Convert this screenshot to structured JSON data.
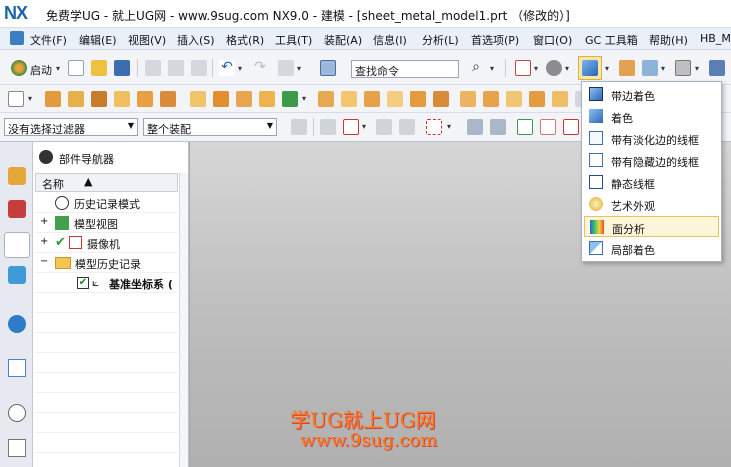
{
  "window": {
    "logo": "NX",
    "title": "免费学UG - 就上UG网 - www.9sug.com NX9.0 - 建模 - [sheet_metal_model1.prt （修改的）]"
  },
  "menubar": [
    {
      "label": "文件(F)"
    },
    {
      "label": "编辑(E)"
    },
    {
      "label": "视图(V)"
    },
    {
      "label": "插入(S)"
    },
    {
      "label": "格式(R)"
    },
    {
      "label": "工具(T)"
    },
    {
      "label": "装配(A)"
    },
    {
      "label": "信息(I)"
    },
    {
      "label": "分析(L)"
    },
    {
      "label": "首选项(P)"
    },
    {
      "label": "窗口(O)"
    },
    {
      "label": "GC 工具箱"
    },
    {
      "label": "帮助(H)"
    },
    {
      "label": "HB_M"
    }
  ],
  "toolbar": {
    "start_label": "启动",
    "search_placeholder": "查找命令"
  },
  "filters": {
    "selection_filter": "没有选择过滤器",
    "assembly_scope": "整个装配"
  },
  "navigator": {
    "title": "部件导航器",
    "column_name": "名称",
    "nodes": [
      {
        "label": "历史记录模式"
      },
      {
        "label": "模型视图"
      },
      {
        "label": "摄像机"
      },
      {
        "label": "模型历史记录"
      },
      {
        "label": "基准坐标系 ("
      }
    ]
  },
  "render_style_menu": {
    "items": [
      {
        "label": "带边着色"
      },
      {
        "label": "着色"
      },
      {
        "label": "带有淡化边的线框"
      },
      {
        "label": "带有隐藏边的线框"
      },
      {
        "label": "静态线框"
      },
      {
        "label": "艺术外观"
      },
      {
        "label": "面分析"
      },
      {
        "label": "局部着色"
      }
    ],
    "highlighted": "面分析"
  },
  "watermark": {
    "line1": "学UG就上UG网",
    "line2": "www.9sug.com"
  },
  "colors": {
    "menubar_bg": "#eaf0f8",
    "toolbar_bg": "#f2f4f8",
    "viewport_bg": "#c4c4c4",
    "highlight_bg": "#fdf5d9",
    "watermark": "#ff7a1a"
  }
}
